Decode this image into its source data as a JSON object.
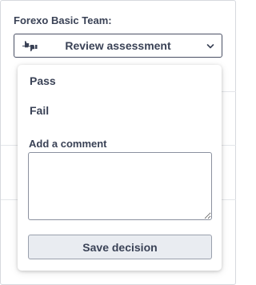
{
  "team": {
    "label": "Forexo Basic Team:"
  },
  "review_button": {
    "label": "Review assessment",
    "icon": "thumbs-up-down-icon",
    "chevron": "chevron-down-icon"
  },
  "dropdown": {
    "options": [
      {
        "label": "Pass"
      },
      {
        "label": "Fail"
      }
    ],
    "comment": {
      "label": "Add a comment",
      "value": "",
      "placeholder": ""
    },
    "save_label": "Save decision"
  },
  "colors": {
    "text": "#3a4256",
    "border": "#4a5064",
    "save_bg": "#e9ecf1"
  }
}
